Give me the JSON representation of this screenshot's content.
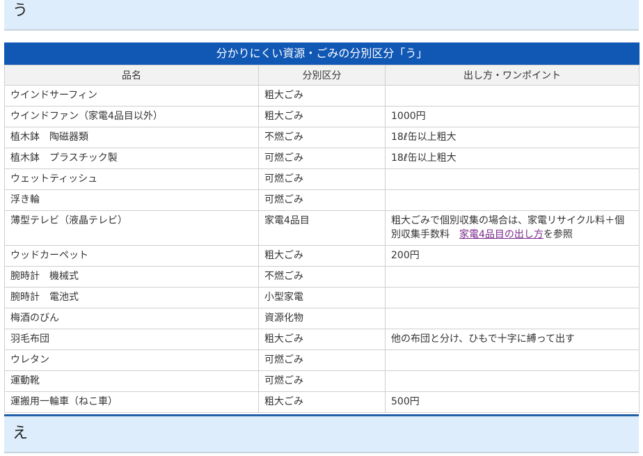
{
  "section_u": "う",
  "section_e": "え",
  "table": {
    "caption": "分かりにくい資源・ごみの分別区分「う」",
    "headers": [
      "品名",
      "分別区分",
      "出し方・ワンポイント"
    ],
    "rows": [
      {
        "name": "ウインドサーフィン",
        "category": "粗大ごみ",
        "note": ""
      },
      {
        "name": "ウインドファン（家電4品目以外）",
        "category": "粗大ごみ",
        "note": "1000円"
      },
      {
        "name": "植木鉢　陶磁器類",
        "category": "不燃ごみ",
        "note": "18ℓ缶以上粗大"
      },
      {
        "name": "植木鉢　プラスチック製",
        "category": "可燃ごみ",
        "note": "18ℓ缶以上粗大"
      },
      {
        "name": "ウェットティッシュ",
        "category": "可燃ごみ",
        "note": ""
      },
      {
        "name": "浮き輪",
        "category": "可燃ごみ",
        "note": ""
      },
      {
        "name": "薄型テレビ（液晶テレビ）",
        "category": "家電4品目",
        "note_parts": {
          "prefix": "粗大ごみで個別収集の場合は、家電リサイクル料＋個別収集手数料　",
          "link": "家電4品目の出し方",
          "suffix": "を参照"
        }
      },
      {
        "name": "ウッドカーペット",
        "category": "粗大ごみ",
        "note": "200円"
      },
      {
        "name": "腕時計　機械式",
        "category": "不燃ごみ",
        "note": ""
      },
      {
        "name": "腕時計　電池式",
        "category": "小型家電",
        "note": ""
      },
      {
        "name": "梅酒のびん",
        "category": "資源化物",
        "note": ""
      },
      {
        "name": "羽毛布団",
        "category": "粗大ごみ",
        "note": "他の布団と分け、ひもで十字に縛って出す"
      },
      {
        "name": "ウレタン",
        "category": "可燃ごみ",
        "note": ""
      },
      {
        "name": "運動靴",
        "category": "可燃ごみ",
        "note": ""
      },
      {
        "name": "運搬用一輪車（ねこ車）",
        "category": "粗大ごみ",
        "note": "500円"
      }
    ]
  }
}
